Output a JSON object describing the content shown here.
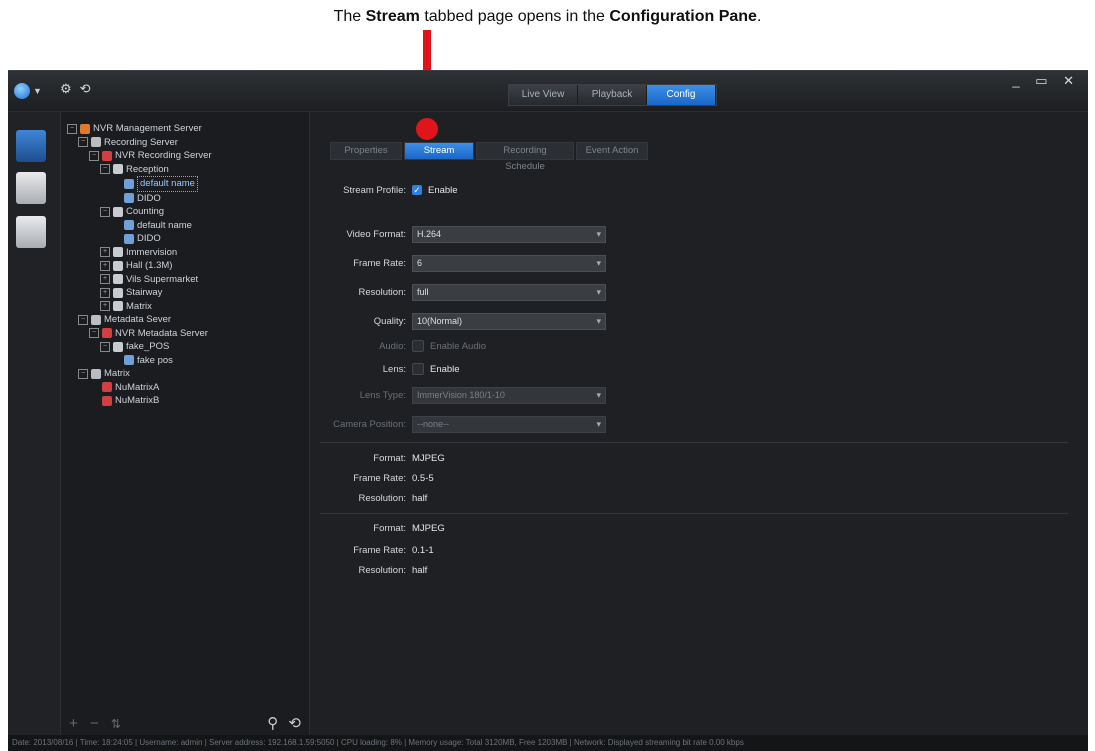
{
  "caption": {
    "pre": "The ",
    "bold1": "Stream",
    "mid": " tabbed page opens in the ",
    "bold2": "Configuration Pane",
    "post": "."
  },
  "window_controls": "_ ▭ ✕",
  "main_tabs": [
    "Live View",
    "Playback",
    "Config"
  ],
  "sub_tabs": [
    "Properties",
    "Stream",
    "Recording Schedule",
    "Event Action"
  ],
  "tree": [
    {
      "label": "NVR Management Server",
      "indent": 0,
      "expand": "−"
    },
    {
      "label": "Recording Server",
      "indent": 1,
      "expand": "−"
    },
    {
      "label": "NVR Recording Server",
      "indent": 2,
      "expand": "−"
    },
    {
      "label": "Reception",
      "indent": 3,
      "expand": "−"
    },
    {
      "label": "default name",
      "indent": 4,
      "expand": "",
      "selected": true
    },
    {
      "label": "DIDO",
      "indent": 4,
      "expand": ""
    },
    {
      "label": "Counting",
      "indent": 3,
      "expand": "−"
    },
    {
      "label": "default name",
      "indent": 4,
      "expand": ""
    },
    {
      "label": "DIDO",
      "indent": 4,
      "expand": ""
    },
    {
      "label": "Immervision",
      "indent": 3,
      "expand": "+"
    },
    {
      "label": "Hall (1.3M)",
      "indent": 3,
      "expand": "+"
    },
    {
      "label": "Vils Supermarket",
      "indent": 3,
      "expand": "+"
    },
    {
      "label": "Stairway",
      "indent": 3,
      "expand": "+"
    },
    {
      "label": "Matrix",
      "indent": 3,
      "expand": "+"
    },
    {
      "label": "Metadata Sever",
      "indent": 1,
      "expand": "−"
    },
    {
      "label": "NVR Metadata Server",
      "indent": 2,
      "expand": "−"
    },
    {
      "label": "fake_POS",
      "indent": 3,
      "expand": "−"
    },
    {
      "label": "fake pos",
      "indent": 4,
      "expand": ""
    },
    {
      "label": "Matrix",
      "indent": 1,
      "expand": "−"
    },
    {
      "label": "NuMatrixA",
      "indent": 2,
      "expand": ""
    },
    {
      "label": "NuMatrixB",
      "indent": 2,
      "expand": ""
    }
  ],
  "tree_footer": {
    "add": "+",
    "remove": "−",
    "sort": "⇅",
    "search": "⚲",
    "refresh": "⟲"
  },
  "stream_profile": {
    "label": "Stream Profile:",
    "checkbox": "Enable",
    "checked": true
  },
  "fields": {
    "video_format": {
      "label": "Video Format:",
      "value": "H.264"
    },
    "frame_rate": {
      "label": "Frame Rate:",
      "value": "6"
    },
    "resolution": {
      "label": "Resolution:",
      "value": "full"
    },
    "quality": {
      "label": "Quality:",
      "value": "10(Normal)"
    },
    "audio": {
      "label": "Audio:",
      "value": "Enable Audio"
    },
    "lens": {
      "label": "Lens:",
      "value": "Enable"
    },
    "lens_type": {
      "label": "Lens Type:",
      "value": "ImmerVision 180/1-10"
    },
    "camera_position": {
      "label": "Camera Position:",
      "value": "--none--"
    }
  },
  "stream2": {
    "format_label": "Format:",
    "format": "MJPEG",
    "rate_label": "Frame Rate:",
    "rate": "0.5-5",
    "res_label": "Resolution:",
    "res": "half"
  },
  "stream3": {
    "format_label": "Format:",
    "format": "MJPEG",
    "rate_label": "Frame Rate:",
    "rate": "0.1-1",
    "res_label": "Resolution:",
    "res": "half"
  },
  "status_bar": "Date: 2013/08/16  |  Time: 18:24:05  |  Username: admin  |  Server address: 192.168.1.59:5050  |  CPU loading: 8%  |  Memory usage: Total 3120MB, Free 1203MB  |  Network: Displayed streaming bit rate    0.00 kbps",
  "colors": {
    "accent": "#1f74d8",
    "pointer": "#e0141b",
    "bg": "#1d1f22"
  }
}
